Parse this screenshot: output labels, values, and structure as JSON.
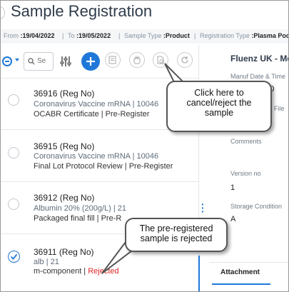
{
  "page": {
    "title": "Sample Registration"
  },
  "filters": {
    "from_label": "From",
    "from_value": ":19/04/2022",
    "to_label": "To",
    "to_value": ":19/05/2022",
    "sample_type_label": "Sample Type",
    "sample_type_value": ":Product",
    "reg_type_label": "Registration Type",
    "reg_type_value": ":Plasma Poo"
  },
  "toolbar": {
    "search_placeholder": "Se"
  },
  "list": [
    {
      "id": "36916 (Reg No)",
      "line2": "Coronavirus Vaccine mRNA |  10046",
      "line3": "OCABR Certificate |",
      "status": "Pre-Register"
    },
    {
      "id": "36915 (Reg No)",
      "line2": "Coronavirus Vaccine mRNA |  10046",
      "line3": "Final Lot Protocol Review |",
      "status": "Pre-Register"
    },
    {
      "id": "36912 (Reg No)",
      "line2": "Albumin 20% (200g/L) |  21",
      "line3": "Packaged final fill |",
      "status": "Pre-R"
    },
    {
      "id": "36911 (Reg No)",
      "line2": "alb |  21",
      "line3": "m-component |",
      "status": "Rejected"
    }
  ],
  "detail": {
    "org": "Fluenz UK - Med",
    "manuf_label": "Manuf Date & Time",
    "manuf_value": "2 00",
    "file_label": "File",
    "comments_label": "Comments",
    "version_label": "Version no",
    "version_value": "1",
    "storage_label": "Storage Condition",
    "storage_value": "A"
  },
  "tabs": {
    "attachment": "Attachment"
  },
  "callouts": {
    "cancel": "Click here to cancel/reject the sample",
    "rejected": "The pre-registered sample is rejected"
  },
  "colors": {
    "accent": "#1f78d8",
    "rejected": "#e02424",
    "title": "#2f3b4a"
  }
}
